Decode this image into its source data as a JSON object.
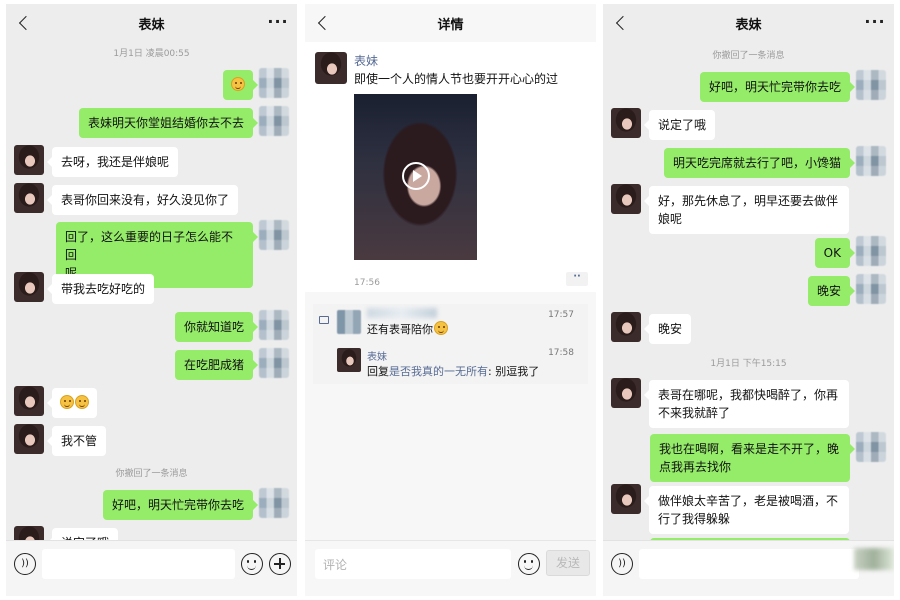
{
  "panel1": {
    "title": "表妹",
    "more": "···",
    "timestamp": "1月1日 凌晨00:55",
    "messages": [
      {
        "side": "right",
        "text": ""
      },
      {
        "side": "right",
        "text": "表妹明天你堂姐结婚你去不去"
      },
      {
        "side": "left",
        "text": "去呀，我还是伴娘呢"
      },
      {
        "side": "left",
        "text": "表哥你回来没有，好久没见你了"
      },
      {
        "side": "right",
        "text": "回了，这么重要的日子怎么能不回",
        "text2": "呢"
      },
      {
        "side": "left",
        "text": "带我去吃好吃的"
      },
      {
        "side": "right",
        "text": "你就知道吃"
      },
      {
        "side": "right",
        "text": "在吃肥成猪"
      },
      {
        "side": "left",
        "text": ""
      },
      {
        "side": "left",
        "text": "我不管"
      },
      {
        "side": "right",
        "text": "好吧，明天忙完带你去吃"
      },
      {
        "side": "left",
        "text": "说定了哦"
      }
    ],
    "recall": "你撤回了一条消息"
  },
  "panel2": {
    "title": "详情",
    "post_name": "表妹",
    "post_text": "即使一个人的情人节也要开开心心的过",
    "post_time": "17:56",
    "dots": "··",
    "comment1_text": "还有表哥陪你",
    "comment1_time": "17:57",
    "comment2_name": "表妹",
    "comment2_time": "17:58",
    "comment2_prefix": "回复",
    "comment2_link": "是否我真的一无所有",
    "comment2_text": ": 别逗我了",
    "input_placeholder": "评论",
    "send": "发送"
  },
  "panel3": {
    "title": "表妹",
    "more": "···",
    "recall": "你撤回了一条消息",
    "timestamp": "1月1日 下午15:15",
    "messages": [
      {
        "side": "right",
        "text": "好吧，明天忙完带你去吃"
      },
      {
        "side": "left",
        "text": "说定了哦"
      },
      {
        "side": "right",
        "text": "明天吃完席就去行了吧，小馋猫"
      },
      {
        "side": "left",
        "text": "好，那先休息了，明早还要去做伴",
        "text2": "娘呢"
      },
      {
        "side": "right",
        "text": "OK"
      },
      {
        "side": "right",
        "text": "晚安"
      },
      {
        "side": "left",
        "text": "晚安"
      },
      {
        "side": "left",
        "text": "表哥在哪呢，我都快喝醉了，你再",
        "text2": "不来我就醉了"
      },
      {
        "side": "right",
        "text": "我也在喝啊，看来是走不开了，晚",
        "text2": "点我再去找你"
      },
      {
        "side": "left",
        "text": "做伴娘太辛苦了，老是被喝酒，不",
        "text2": "行了我得躲躲"
      }
    ]
  }
}
